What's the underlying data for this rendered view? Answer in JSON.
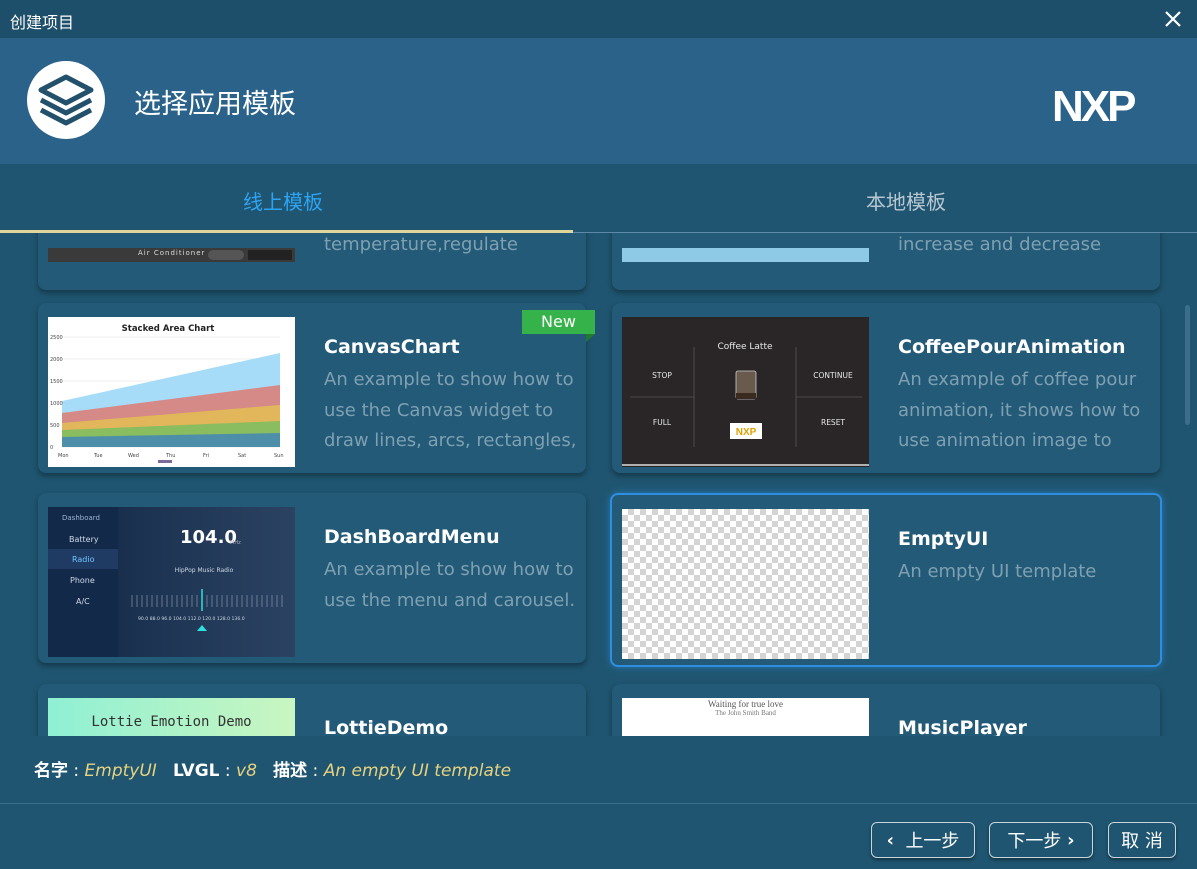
{
  "window": {
    "title": "创建项目"
  },
  "banner": {
    "heading": "选择应用模板",
    "brand": "NXP"
  },
  "tabs": [
    {
      "label": "线上模板"
    },
    {
      "label": "本地模板"
    }
  ],
  "cards": [
    {
      "title": "",
      "description": "temperature,regulate",
      "thumb_text": "Air Conditioner"
    },
    {
      "title": "",
      "description": "increase and decrease"
    },
    {
      "title": "CanvasChart",
      "description": "An example to show how to use the Canvas widget to draw lines, arcs, rectangles,",
      "badge": "New",
      "thumb": {
        "title": "Stacked Area Chart",
        "xlabels": [
          "Mon",
          "Tue",
          "Wed",
          "Thu",
          "Fri",
          "Sat",
          "Sun"
        ],
        "ylabels": [
          "2500",
          "2000",
          "1500",
          "1000",
          "500",
          "0"
        ]
      }
    },
    {
      "title": "CoffeePourAnimation",
      "description": "An example of coffee pour animation, it shows how to use animation image to",
      "thumb": {
        "title": "Coffee Latte",
        "stop": "STOP",
        "full": "FULL",
        "continue": "CONTINUE",
        "reset": "RESET"
      }
    },
    {
      "title": "DashBoardMenu",
      "description": "An example to show how to use the menu and carousel.",
      "thumb": {
        "menu_title": "Dashboard",
        "items": [
          "Battery",
          "Radio",
          "Phone",
          "A/C"
        ],
        "freq": "104.0",
        "unit": "MHz",
        "station": "HipPop Music Radio",
        "scale": "90.0   88.0   96.0  104.0  112.0  120.0  128.0  136.0"
      }
    },
    {
      "title": "EmptyUI",
      "description": "An empty UI template",
      "selected": true
    },
    {
      "title": "LottieDemo",
      "description": "",
      "thumb": {
        "title": "Lottie Emotion Demo"
      }
    },
    {
      "title": "MusicPlayer",
      "description": "",
      "thumb": {
        "line1": "Waiting for true love",
        "line2": "The John Smith Band"
      }
    }
  ],
  "info": {
    "name_label": "名字",
    "name_value": "EmptyUI",
    "lvgl_label": "LVGL",
    "lvgl_value": "v8",
    "desc_label": "描述",
    "desc_value": "An empty UI template"
  },
  "buttons": {
    "prev": "上一步",
    "next": "下一步",
    "cancel": "取 消"
  },
  "colors": {
    "accent": "#2ea3f2",
    "badge": "#36b24a",
    "highlight": "#e6d280"
  }
}
